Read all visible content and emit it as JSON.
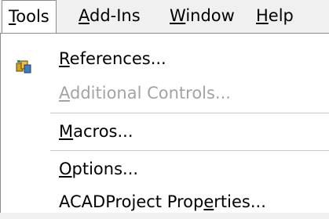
{
  "menubar": {
    "items": [
      {
        "pre": "",
        "mn": "T",
        "post": "ools"
      },
      {
        "pre": "",
        "mn": "A",
        "post": "dd-Ins"
      },
      {
        "pre": "",
        "mn": "W",
        "post": "indow"
      },
      {
        "pre": "",
        "mn": "H",
        "post": "elp"
      }
    ],
    "active": "Tools"
  },
  "dropdown": {
    "items": [
      {
        "pre": "",
        "mn": "R",
        "post": "eferences...",
        "enabled": true,
        "icon": "references-icon"
      },
      {
        "pre": "",
        "mn": "A",
        "post": "dditional Controls...",
        "enabled": false
      },
      {
        "pre": "",
        "mn": "M",
        "post": "acros...",
        "enabled": true
      },
      {
        "pre": "",
        "mn": "O",
        "post": "ptions...",
        "enabled": true
      },
      {
        "pre": "ACADProject Prop",
        "mn": "e",
        "post": "rties...",
        "enabled": true
      }
    ]
  },
  "colors": {
    "menu_background": "#ffffff",
    "bar_background": "#f0f0f0",
    "disabled_text": "#a3a3a3",
    "separator": "#c8c8c8"
  }
}
